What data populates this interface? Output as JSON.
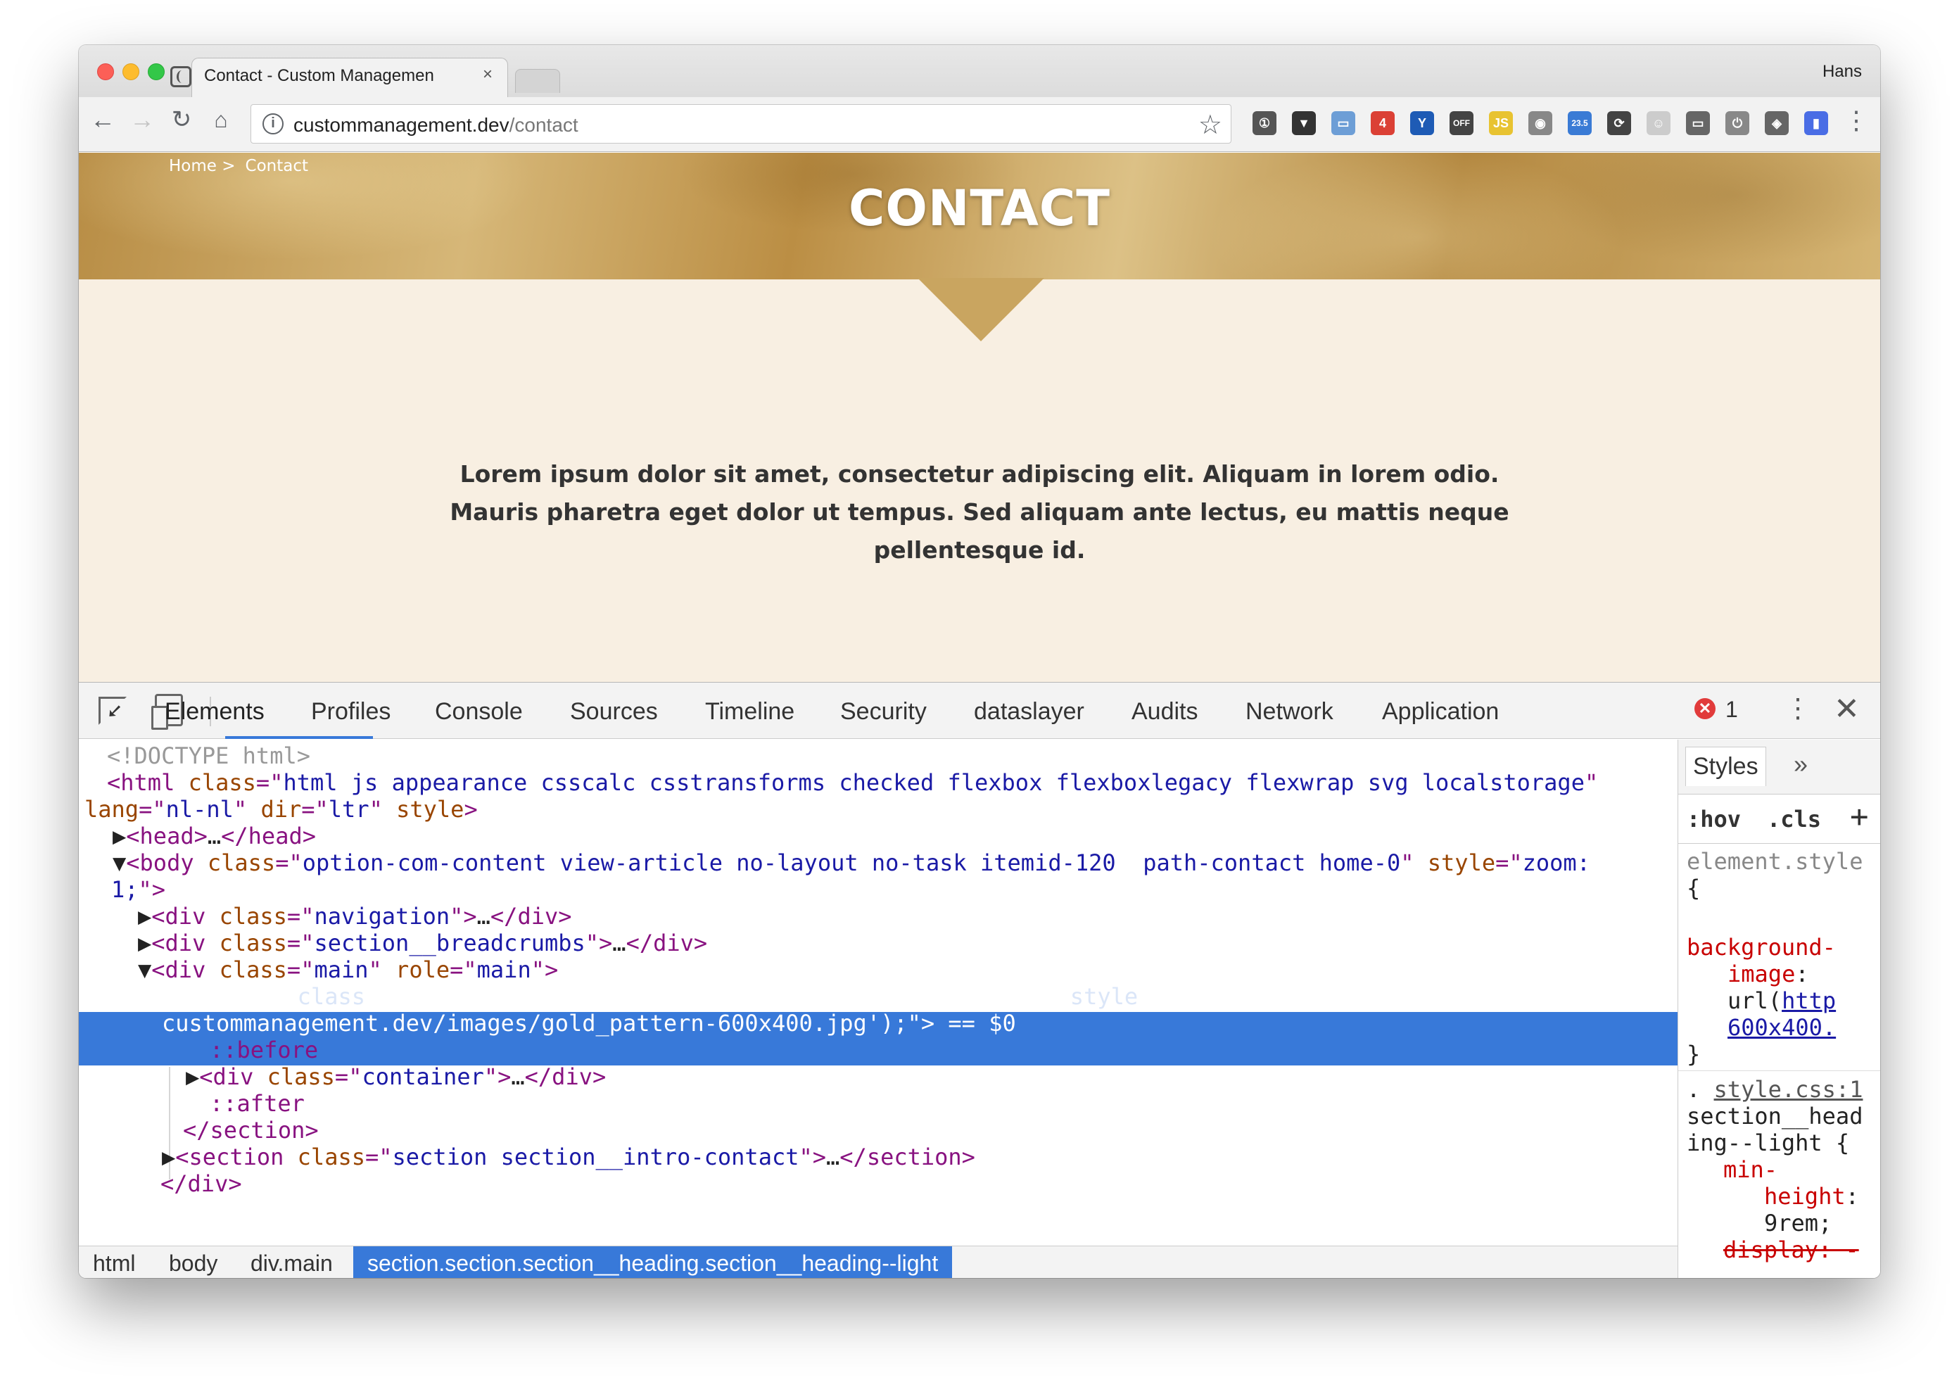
{
  "browser": {
    "tab_title": "Contact - Custom Managemen",
    "tab_close": "×",
    "profile_name": "Hans",
    "url_host": "custommanagement.dev",
    "url_path": "/contact",
    "extensions": [
      {
        "name": "onepassword-icon",
        "color": "#555555",
        "label": "①"
      },
      {
        "name": "pocket-icon",
        "color": "#333333",
        "label": "▼"
      },
      {
        "name": "window-icon",
        "color": "#6d9ed6",
        "label": "▭"
      },
      {
        "name": "todoist-icon",
        "color": "#db4035",
        "label": "4"
      },
      {
        "name": "y-icon",
        "color": "#1e5bb5",
        "label": "Y"
      },
      {
        "name": "off-icon",
        "color": "#444444",
        "label": "OFF"
      },
      {
        "name": "js-icon",
        "color": "#e8c331",
        "label": "JS"
      },
      {
        "name": "camera-icon",
        "color": "#888888",
        "label": "◉"
      },
      {
        "name": "speed-icon",
        "color": "#3a7bd5",
        "label": "23.5"
      },
      {
        "name": "sync-icon",
        "color": "#444444",
        "label": "⟳"
      },
      {
        "name": "ghost-icon",
        "color": "#cccccc",
        "label": "☺"
      },
      {
        "name": "cast-icon",
        "color": "#666666",
        "label": "▭"
      },
      {
        "name": "power-icon",
        "color": "#888888",
        "label": "⏻"
      },
      {
        "name": "ublock-icon",
        "color": "#666666",
        "label": "◈"
      },
      {
        "name": "colorpick-icon",
        "color": "#4a6de5",
        "label": "▮"
      }
    ]
  },
  "page": {
    "breadcrumb_home": "Home >",
    "breadcrumb_current": "Contact",
    "title": "CONTACT",
    "intro_line1": "Lorem ipsum dolor sit amet, consectetur adipiscing elit. Aliquam in lorem odio.",
    "intro_line2": "Mauris pharetra eget dolor ut tempus. Sed aliquam ante lectus, eu mattis neque",
    "intro_line3": "pellentesque id."
  },
  "devtools": {
    "tabs": [
      "Elements",
      "Profiles",
      "Console",
      "Sources",
      "Timeline",
      "Security",
      "dataslayer",
      "Audits",
      "Network",
      "Application"
    ],
    "error_count": "1",
    "breadcrumbs": [
      "html",
      "body",
      "div.main"
    ],
    "breadcrumb_active": "section.section.section__heading.section__heading--light",
    "styles_tab": "Styles",
    "hov": ":hov",
    "cls": ".cls"
  }
}
